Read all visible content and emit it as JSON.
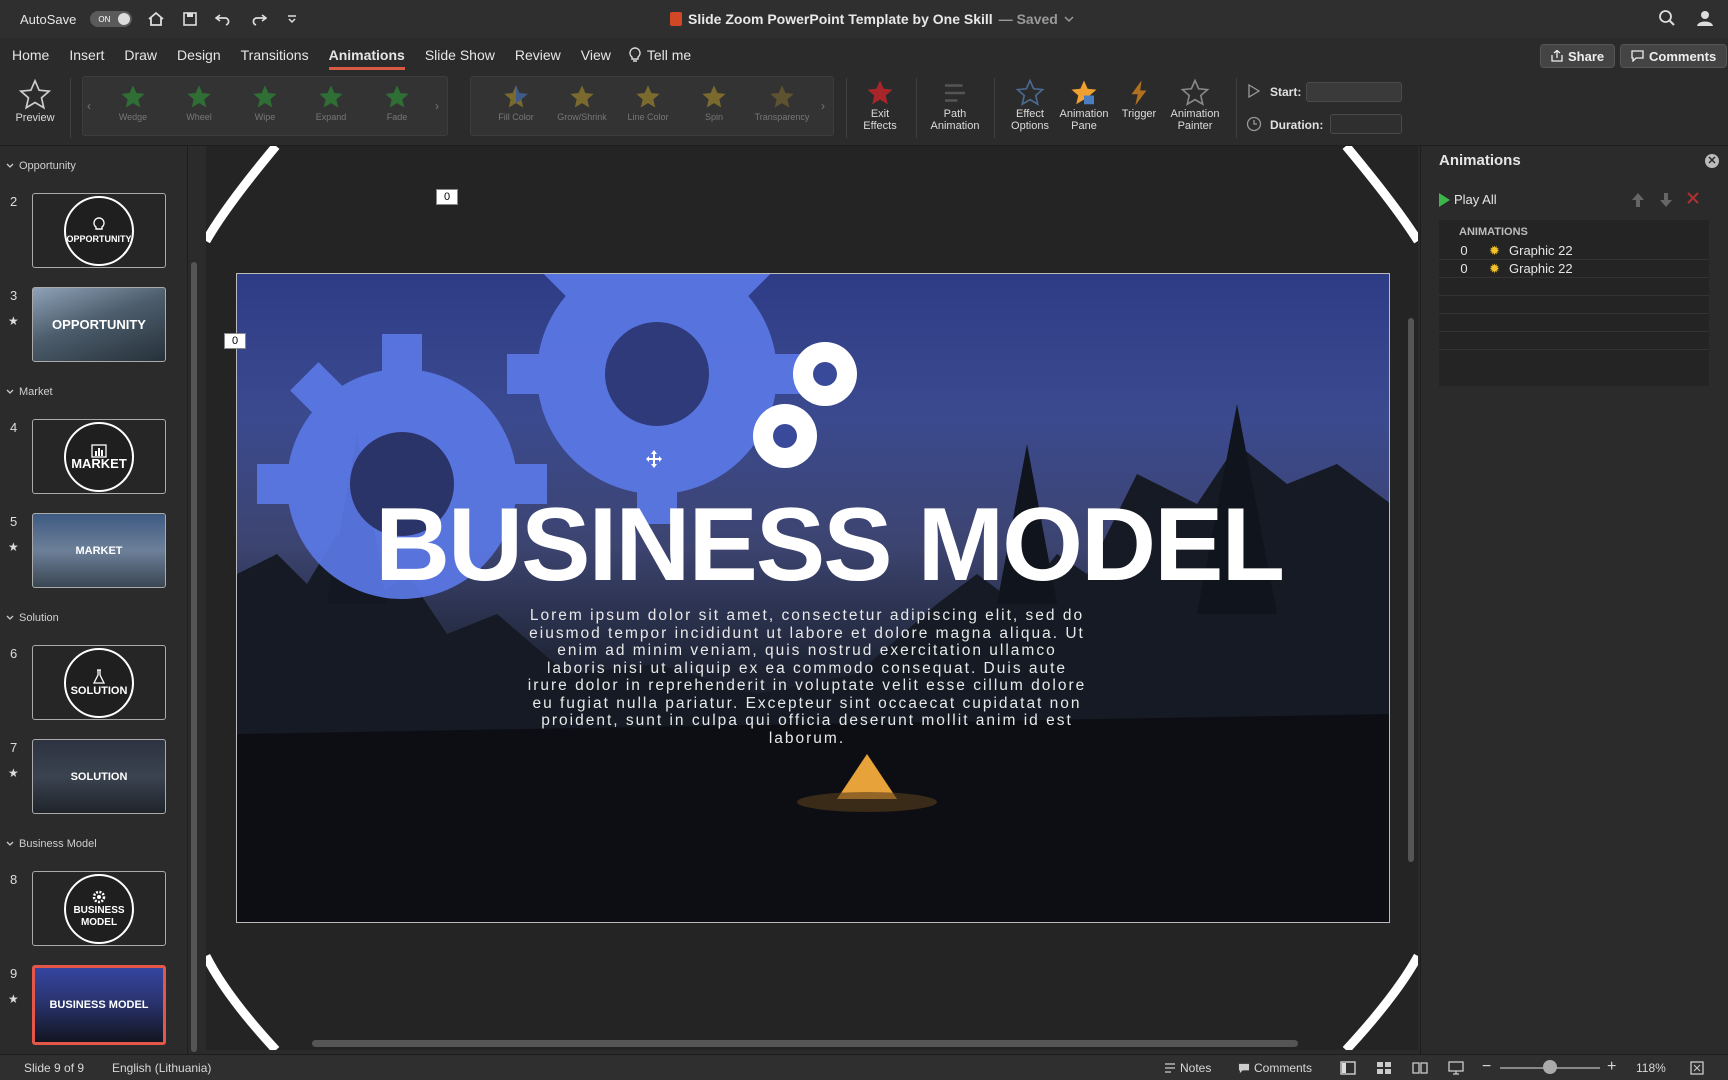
{
  "titlebar": {
    "autosave_label": "AutoSave",
    "autosave_state": "ON",
    "document_title": "Slide Zoom PowerPoint Template by One Skill",
    "save_status": "— Saved",
    "accent_color": "#d24726"
  },
  "menu": {
    "tabs": [
      "Home",
      "Insert",
      "Draw",
      "Design",
      "Transitions",
      "Animations",
      "Slide Show",
      "Review",
      "View"
    ],
    "active_tab": "Animations",
    "tell_me": "Tell me",
    "share_label": "Share",
    "comments_label": "Comments"
  },
  "ribbon": {
    "preview_label": "Preview",
    "entrance_effects": [
      "Wedge",
      "Wheel",
      "Wipe",
      "Expand",
      "Fade"
    ],
    "emphasis_effects": [
      "Fill Color",
      "Grow/Shrink",
      "Line Color",
      "Spin",
      "Transparency"
    ],
    "exit_effects_label": "Exit\nEffects",
    "path_animation_label": "Path\nAnimation",
    "effect_options_label": "Effect\nOptions",
    "animation_pane_label": "Animation\nPane",
    "trigger_label": "Trigger",
    "animation_painter_label": "Animation\nPainter",
    "start_label": "Start:",
    "duration_label": "Duration:"
  },
  "thumbnails": {
    "sections": [
      "Opportunity",
      "Market",
      "Solution",
      "Business Model"
    ],
    "slides": [
      {
        "num": "2",
        "label": "OPPORTUNITY",
        "star": false
      },
      {
        "num": "3",
        "label": "OPPORTUNITY",
        "star": true
      },
      {
        "num": "4",
        "label": "MARKET",
        "star": false
      },
      {
        "num": "5",
        "label": "MARKET",
        "star": true
      },
      {
        "num": "6",
        "label": "SOLUTION",
        "star": false
      },
      {
        "num": "7",
        "label": "SOLUTION",
        "star": true
      },
      {
        "num": "8",
        "label": "BUSINESS MODEL",
        "star": false
      },
      {
        "num": "9",
        "label": "BUSINESS MODEL",
        "star": true
      }
    ],
    "star_glyph": "★"
  },
  "slide": {
    "title": "BUSINESS MODEL",
    "body": "Lorem ipsum dolor sit amet, consectetur adipiscing elit, sed do eiusmod tempor incididunt ut labore et dolore magna aliqua. Ut enim ad minim veniam, quis nostrud exercitation ullamco laboris nisi ut aliquip ex ea commodo consequat. Duis aute irure dolor in reprehenderit in voluptate velit esse cillum dolore eu fugiat nulla pariatur. Excepteur sint occaecat cupidatat non proident, sunt in culpa qui officia deserunt mollit anim id est laborum.",
    "anim_tag_1": "0",
    "anim_tag_2": "0",
    "gear_color": "#5b78e6"
  },
  "animation_pane": {
    "title": "Animations",
    "play_all": "Play All",
    "list_header": "ANIMATIONS",
    "items": [
      {
        "order": "0",
        "name": "Graphic 22"
      },
      {
        "order": "0",
        "name": "Graphic 22"
      }
    ],
    "close_glyph": "✕"
  },
  "statusbar": {
    "slide_info": "Slide 9 of 9",
    "language": "English (Lithuania)",
    "notes_label": "Notes",
    "comments_label": "Comments",
    "zoom_level": "118%",
    "zoom_fraction": 0.5
  }
}
